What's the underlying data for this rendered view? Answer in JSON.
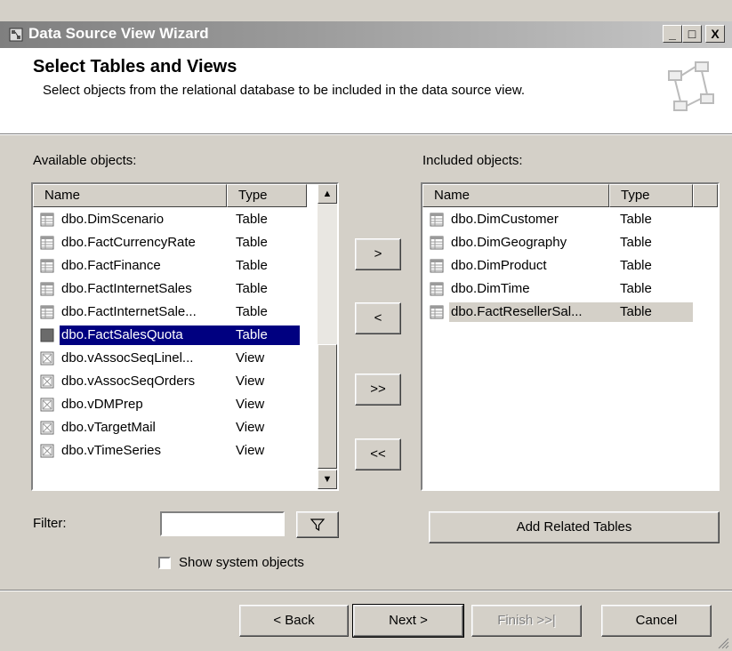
{
  "window": {
    "title": "Data Source View Wizard",
    "min_label": "_",
    "max_label": "□",
    "close_label": "X"
  },
  "header": {
    "title": "Select Tables and Views",
    "description": "Select objects from the relational database to be included in the data source view."
  },
  "available": {
    "label": "Available objects:",
    "columns": [
      "Name",
      "Type"
    ],
    "rows": [
      {
        "name": "dbo.DimScenario",
        "type": "Table",
        "icon": "table-icon"
      },
      {
        "name": "dbo.FactCurrencyRate",
        "type": "Table",
        "icon": "table-icon"
      },
      {
        "name": "dbo.FactFinance",
        "type": "Table",
        "icon": "table-icon"
      },
      {
        "name": "dbo.FactInternetSales",
        "type": "Table",
        "icon": "table-icon"
      },
      {
        "name": "dbo.FactInternetSale...",
        "type": "Table",
        "icon": "table-icon"
      },
      {
        "name": "dbo.FactSalesQuota",
        "type": "Table",
        "icon": "table-icon",
        "selected": true
      },
      {
        "name": "dbo.vAssocSeqLinel...",
        "type": "View",
        "icon": "view-icon"
      },
      {
        "name": "dbo.vAssocSeqOrders",
        "type": "View",
        "icon": "view-icon"
      },
      {
        "name": "dbo.vDMPrep",
        "type": "View",
        "icon": "view-icon"
      },
      {
        "name": "dbo.vTargetMail",
        "type": "View",
        "icon": "view-icon"
      },
      {
        "name": "dbo.vTimeSeries",
        "type": "View",
        "icon": "view-icon"
      }
    ]
  },
  "included": {
    "label": "Included objects:",
    "columns": [
      "Name",
      "Type"
    ],
    "rows": [
      {
        "name": "dbo.DimCustomer",
        "type": "Table",
        "icon": "table-icon"
      },
      {
        "name": "dbo.DimGeography",
        "type": "Table",
        "icon": "table-icon"
      },
      {
        "name": "dbo.DimProduct",
        "type": "Table",
        "icon": "table-icon"
      },
      {
        "name": "dbo.DimTime",
        "type": "Table",
        "icon": "table-icon"
      },
      {
        "name": "dbo.FactResellerSal...",
        "type": "Table",
        "icon": "table-icon",
        "selected": true
      }
    ]
  },
  "move_buttons": {
    "add": ">",
    "remove": "<",
    "add_all": ">>",
    "remove_all": "<<"
  },
  "filter": {
    "label": "Filter:",
    "value": "",
    "show_system": "Show system objects",
    "show_system_checked": false
  },
  "add_related": "Add Related Tables",
  "footer": {
    "back": "< Back",
    "next": "Next >",
    "finish": "Finish >>|",
    "cancel": "Cancel"
  }
}
